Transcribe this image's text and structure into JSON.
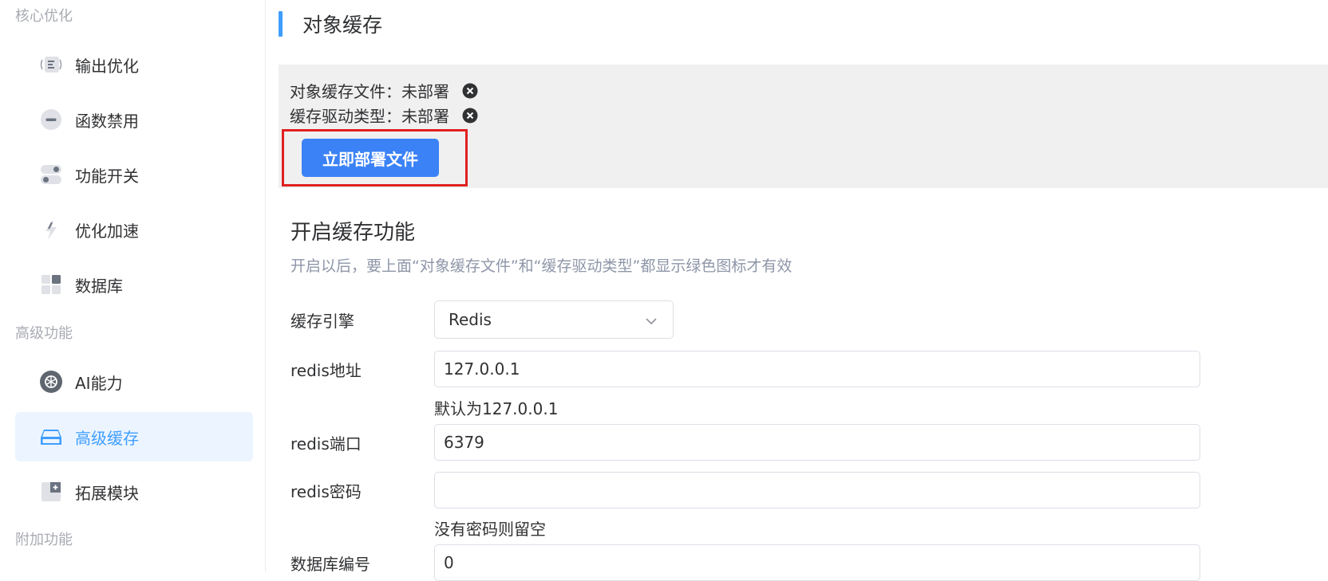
{
  "sidebar": {
    "sections": [
      {
        "label": "核心优化"
      },
      {
        "label": "高级功能"
      },
      {
        "label": "附加功能"
      }
    ],
    "items": [
      {
        "label": "输出优化",
        "icon": "output-optimize-icon"
      },
      {
        "label": "函数禁用",
        "icon": "minus-circle-icon"
      },
      {
        "label": "功能开关",
        "icon": "toggle-icon"
      },
      {
        "label": "优化加速",
        "icon": "lightning-icon"
      },
      {
        "label": "数据库",
        "icon": "database-grid-icon"
      },
      {
        "label": "AI能力",
        "icon": "ai-icon"
      },
      {
        "label": "高级缓存",
        "icon": "cache-icon",
        "active": true
      },
      {
        "label": "拓展模块",
        "icon": "extension-icon"
      }
    ]
  },
  "main": {
    "title": "对象缓存",
    "status": {
      "file_label": "对象缓存文件：未部署",
      "driver_label": "缓存驱动类型：未部署",
      "deploy_button": "立即部署文件"
    },
    "section": {
      "title": "开启缓存功能",
      "description": "开启以后，要上面“对象缓存文件”和“缓存驱动类型”都显示绿色图标才有效"
    },
    "form": {
      "engine_label": "缓存引擎",
      "engine_value": "Redis",
      "host_label": "redis地址",
      "host_value": "127.0.0.1",
      "host_help": "默认为127.0.0.1",
      "port_label": "redis端口",
      "port_value": "6379",
      "password_label": "redis密码",
      "password_value": "",
      "password_help": "没有密码则留空",
      "db_label": "数据库编号",
      "db_value": "0"
    }
  },
  "colors": {
    "accent": "#409eff",
    "button": "#3b82f6",
    "highlight": "#e02020",
    "panel": "#f0f0f0",
    "muted": "#a8abb2"
  }
}
